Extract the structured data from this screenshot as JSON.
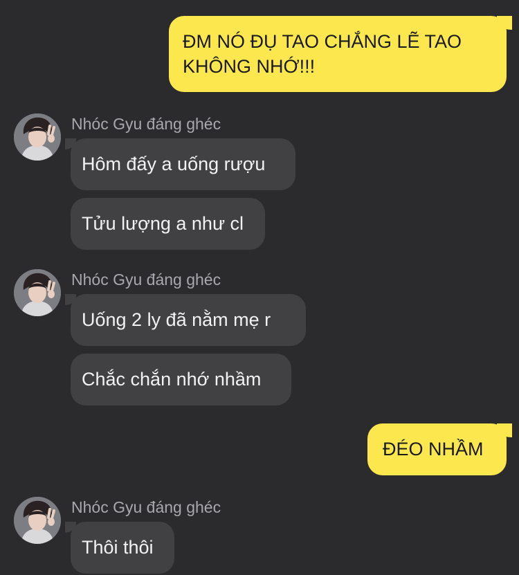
{
  "colors": {
    "background": "#2b2b2d",
    "outgoing_bubble": "#fde74f",
    "incoming_bubble": "#414144",
    "sender_name": "#a8a8ad"
  },
  "messages": [
    {
      "direction": "outgoing",
      "text": "ĐM NÓ ĐỤ TAO CHẮNG LẼ TAO\nKHÔNG NHỚ!!!"
    },
    {
      "direction": "incoming_group",
      "sender": "Nhóc Gyu đáng ghéc",
      "avatar_icon": "profile-photo-icon",
      "bubbles": [
        "Hôm đấy a uống rượu",
        "Tửu lượng a như cl"
      ]
    },
    {
      "direction": "incoming_group",
      "sender": "Nhóc Gyu đáng ghéc",
      "avatar_icon": "profile-photo-icon",
      "bubbles": [
        "Uống 2 ly đã nằm mẹ r",
        "Chắc chắn nhớ nhầm"
      ]
    },
    {
      "direction": "outgoing",
      "text": "ĐÉO NHẦM"
    },
    {
      "direction": "incoming_group",
      "sender": "Nhóc Gyu đáng ghéc",
      "avatar_icon": "profile-photo-icon",
      "bubbles": [
        "Thôi thôi"
      ]
    }
  ]
}
